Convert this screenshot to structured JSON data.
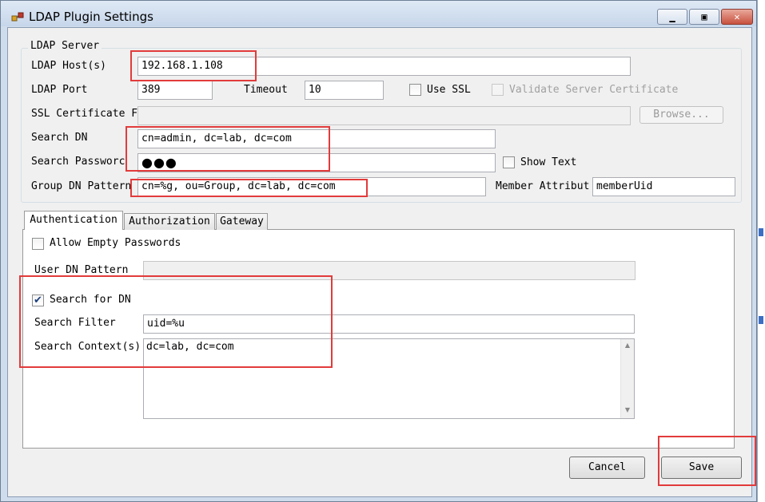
{
  "window": {
    "title": "LDAP Plugin Settings",
    "app_icon": "ldap-plugin-icon",
    "controls": {
      "minimize": "minimize-icon",
      "maximize": "maximize-icon",
      "close": "close-icon"
    }
  },
  "server": {
    "group_label": "LDAP Server",
    "host_label": "LDAP Host(s)",
    "host_value": "192.168.1.108",
    "port_label": "LDAP Port",
    "port_value": "389",
    "timeout_label": "Timeout",
    "timeout_value": "10",
    "use_ssl_label": "Use SSL",
    "use_ssl_checked": false,
    "validate_cert_label": "Validate Server Certificate",
    "validate_cert_checked": false,
    "ssl_cert_label": "SSL Certificate F",
    "ssl_cert_value": "",
    "browse_label": "Browse...",
    "search_dn_label": "Search DN",
    "search_dn_value": "cn=admin, dc=lab, dc=com",
    "search_password_label": "Search Passworc",
    "search_password_masked": "●●●",
    "show_text_label": "Show Text",
    "show_text_checked": false,
    "group_dn_label": "Group DN Pattern",
    "group_dn_value": "cn=%g, ou=Group, dc=lab, dc=com",
    "member_attr_label": "Member Attribut",
    "member_attr_value": "memberUid"
  },
  "tabs": [
    {
      "label": "Authentication",
      "active": true
    },
    {
      "label": "Authorization",
      "active": false
    },
    {
      "label": "Gateway",
      "active": false
    }
  ],
  "auth": {
    "allow_empty_label": "Allow Empty Passwords",
    "allow_empty_checked": false,
    "user_dn_label": "User DN Pattern",
    "user_dn_value": "",
    "search_for_dn_label": "Search for DN",
    "search_for_dn_checked": true,
    "search_filter_label": "Search Filter",
    "search_filter_value": "uid=%u",
    "search_context_label": "Search Context(s)",
    "search_context_value": "dc=lab, dc=com"
  },
  "footer": {
    "cancel_label": "Cancel",
    "save_label": "Save"
  },
  "colors": {
    "highlight": "#e23b3b",
    "window_frame": "#cfdcec",
    "panel": "#f0f0f0"
  }
}
